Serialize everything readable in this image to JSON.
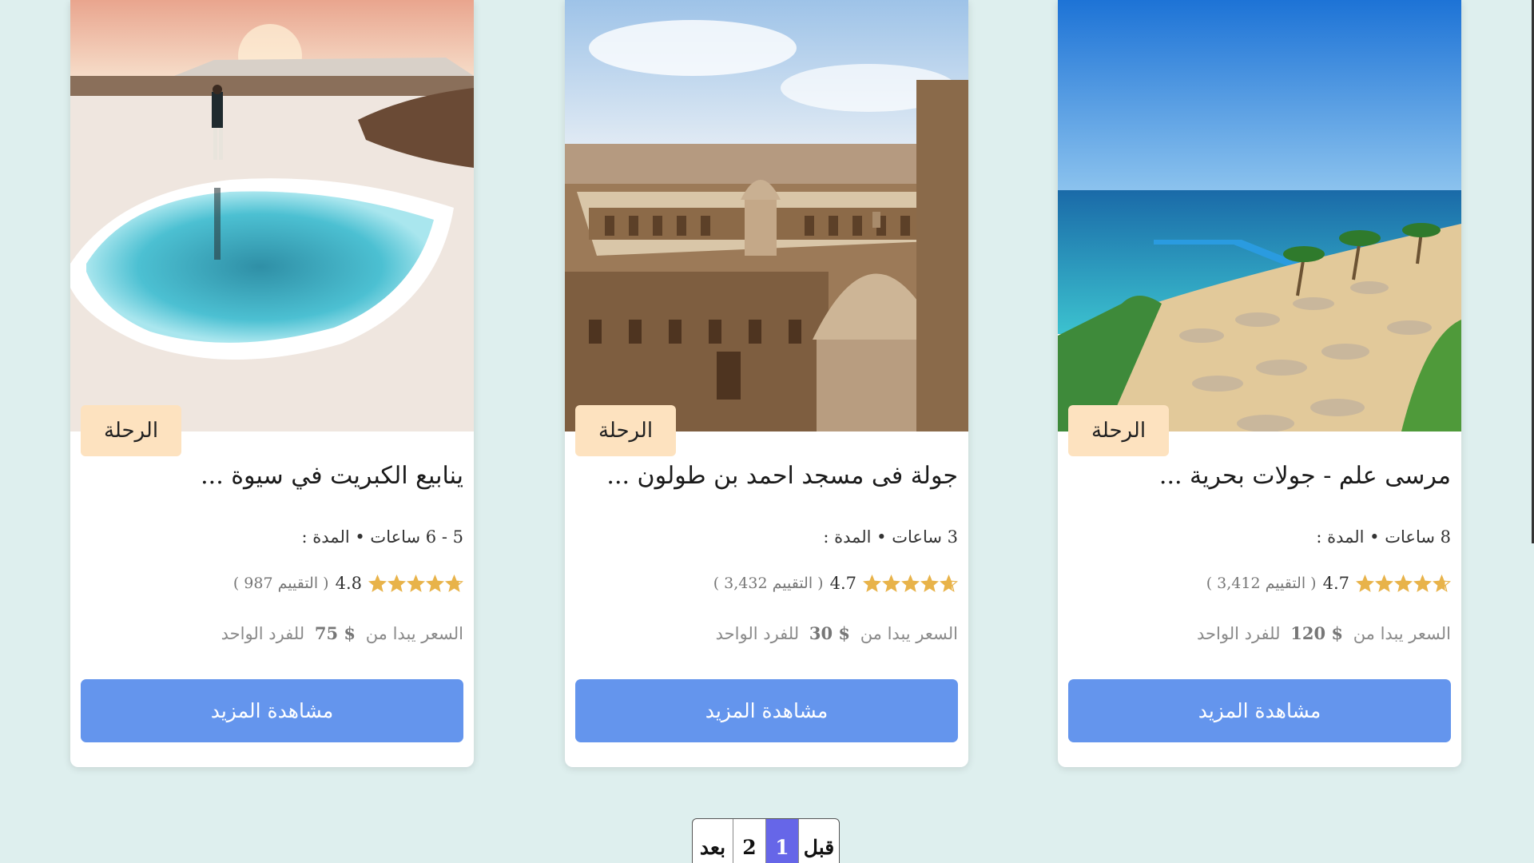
{
  "cards": [
    {
      "badge": "الرحلة",
      "title": "ينابيع الكبريت في سيوة ...",
      "duration": "5 - 6 ساعات • المدة :",
      "rating_score": "4.8",
      "rating_count": "( التقييم 987 )",
      "stars": 4.8,
      "price_prefix": "السعر يبدا من",
      "price_amount": "$ 75",
      "price_suffix": "للفرد الواحد",
      "button": "مشاهدة المزيد"
    },
    {
      "badge": "الرحلة",
      "title": "جولة فى مسجد احمد بن طولون ...",
      "duration": "3 ساعات • المدة :",
      "rating_score": "4.7",
      "rating_count": "( التقييم 3,432 )",
      "stars": 4.7,
      "price_prefix": "السعر يبدا من",
      "price_amount": "$ 30",
      "price_suffix": "للفرد الواحد",
      "button": "مشاهدة المزيد"
    },
    {
      "badge": "الرحلة",
      "title": "مرسى علم - جولات بحرية ...",
      "duration": "8 ساعات • المدة :",
      "rating_score": "4.7",
      "rating_count": "( التقييم 3,412 )",
      "stars": 4.7,
      "price_prefix": "السعر يبدا من",
      "price_amount": "$ 120",
      "price_suffix": "للفرد الواحد",
      "button": "مشاهدة المزيد"
    }
  ],
  "pagination": {
    "next": "بعد",
    "page2": "2",
    "page1": "1",
    "prev": "قبل",
    "active_page": 1
  },
  "colors": {
    "background": "#deefee",
    "badge": "#fde2bf",
    "button": "#6495ed",
    "star": "#e8b34a",
    "pager_active": "#6666e8"
  }
}
